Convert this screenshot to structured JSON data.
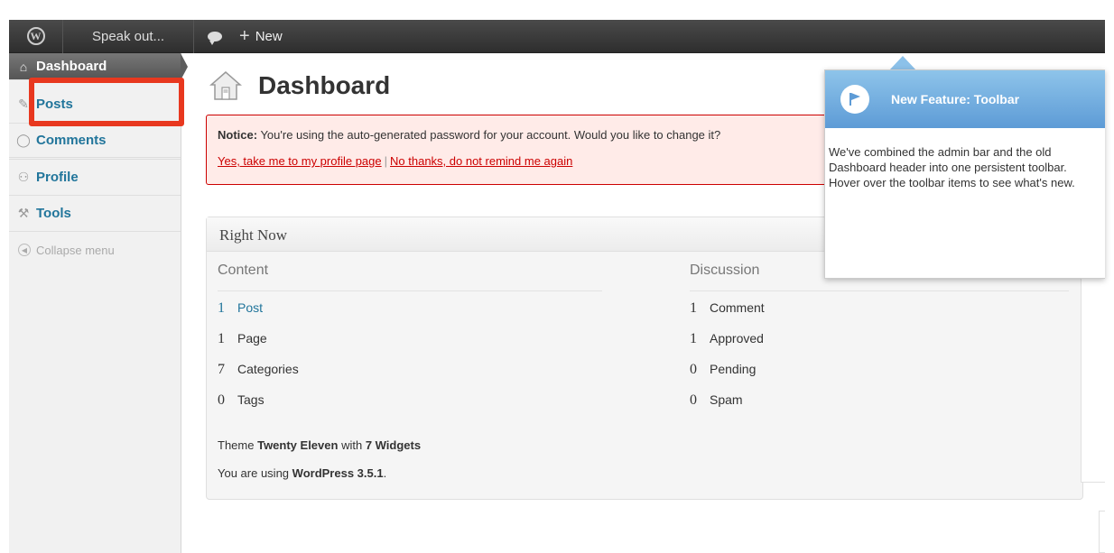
{
  "adminbar": {
    "site_name": "Speak out...",
    "new_label": "New"
  },
  "sidebar": {
    "items": [
      {
        "label": "Dashboard"
      },
      {
        "label": "Posts"
      },
      {
        "label": "Comments"
      },
      {
        "label": "Profile"
      },
      {
        "label": "Tools"
      }
    ],
    "collapse_label": "Collapse menu"
  },
  "page": {
    "title": "Dashboard"
  },
  "notice": {
    "prefix": "Notice:",
    "text": "You're using the auto-generated password for your account. Would you like to change it?",
    "link_yes": "Yes, take me to my profile page",
    "separator": "|",
    "link_no": "No thanks, do not remind me again"
  },
  "right_now": {
    "title": "Right Now",
    "content_title": "Content",
    "discussion_title": "Discussion",
    "content": [
      {
        "num": "1",
        "label": "Post"
      },
      {
        "num": "1",
        "label": "Page"
      },
      {
        "num": "7",
        "label": "Categories"
      },
      {
        "num": "0",
        "label": "Tags"
      }
    ],
    "discussion": [
      {
        "num": "1",
        "label": "Comment"
      },
      {
        "num": "1",
        "label": "Approved"
      },
      {
        "num": "0",
        "label": "Pending"
      },
      {
        "num": "0",
        "label": "Spam"
      }
    ],
    "theme_prefix": "Theme",
    "theme_name": "Twenty Eleven",
    "theme_with": "with",
    "widgets": "7 Widgets",
    "version_prefix": "You are using",
    "version": "WordPress 3.5.1",
    "version_suffix": "."
  },
  "pointer": {
    "title": "New Feature: Toolbar",
    "body": "We've combined the admin bar and the old Dashboard header into one persistent toolbar. Hover over the toolbar items to see what's new."
  },
  "colors": {
    "highlight": "#e8381f",
    "link": "#21759b",
    "pointer_head": "#5d9bd6"
  }
}
